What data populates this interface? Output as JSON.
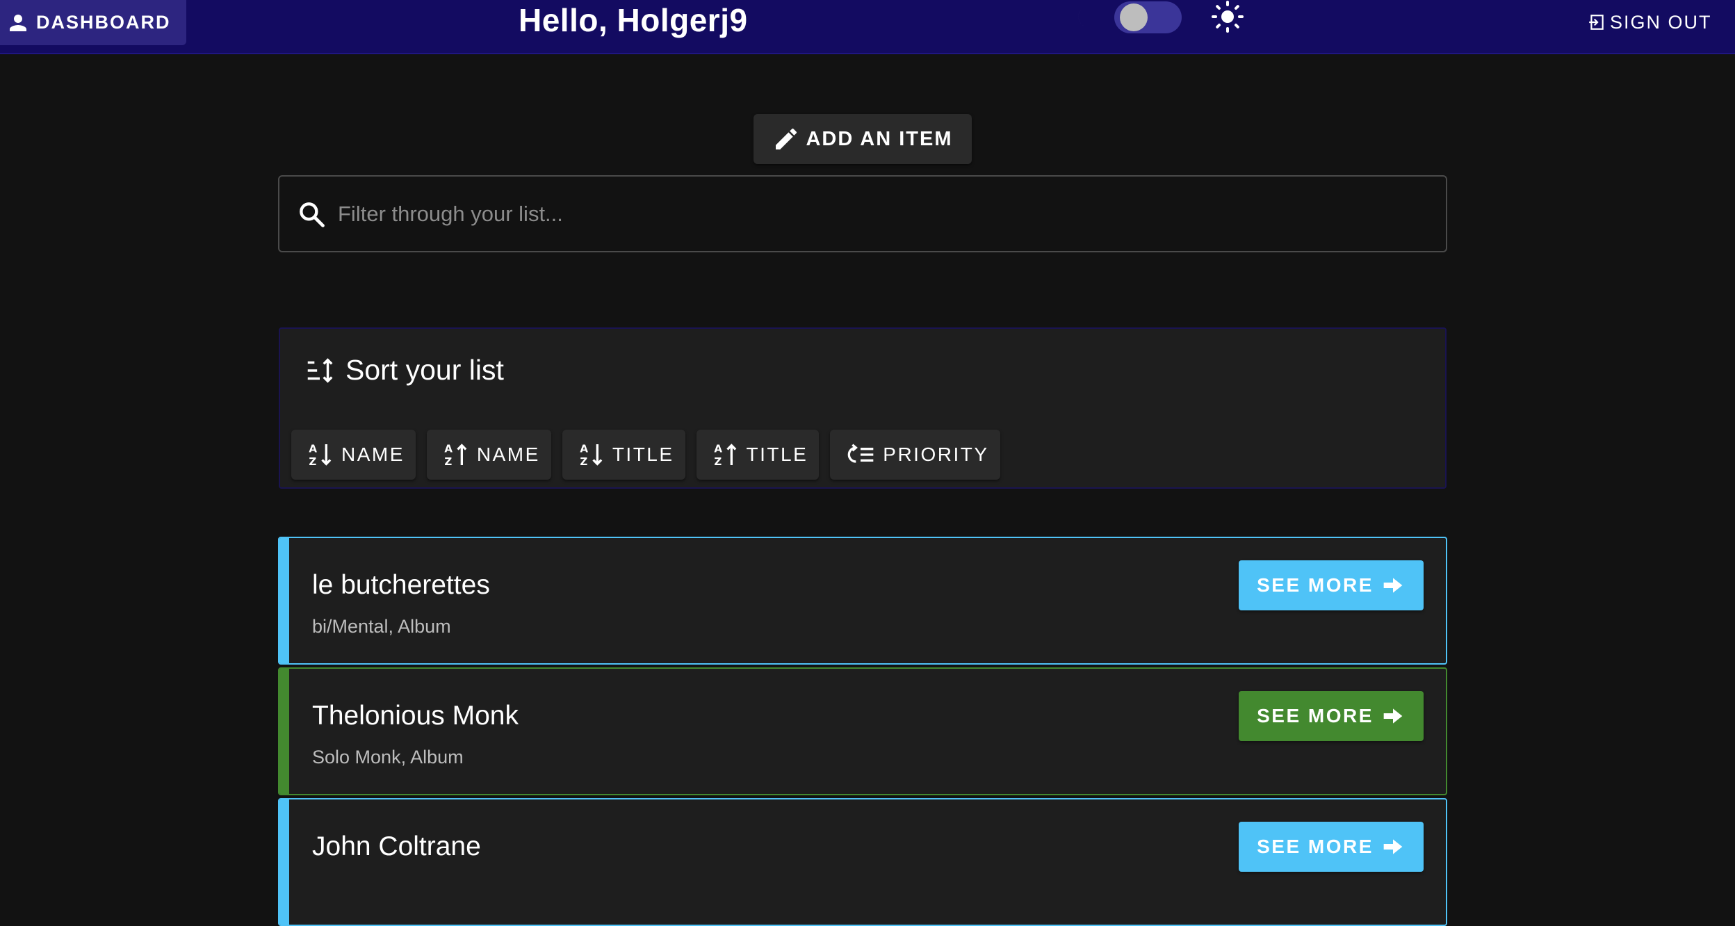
{
  "header": {
    "dashboard_label": "DASHBOARD",
    "greeting": "Hello, Holgerj9",
    "signout_label": "SIGN OUT",
    "theme_toggle": {
      "dark_mode": false
    }
  },
  "toolbar": {
    "add_item_label": "ADD AN ITEM"
  },
  "search": {
    "placeholder": "Filter through your list...",
    "value": ""
  },
  "sort": {
    "title": "Sort your list",
    "buttons": [
      {
        "label": "NAME",
        "icon": "sort-alpha-down-icon"
      },
      {
        "label": "NAME",
        "icon": "sort-alpha-up-icon"
      },
      {
        "label": "TITLE",
        "icon": "sort-alpha-down-icon"
      },
      {
        "label": "TITLE",
        "icon": "sort-alpha-up-icon"
      },
      {
        "label": "PRIORITY",
        "icon": "priority-icon"
      }
    ]
  },
  "items": [
    {
      "name": "le butcherettes",
      "subtitle": "bi/Mental, Album",
      "button_label": "SEE MORE",
      "color": "#4fc3f7"
    },
    {
      "name": "Thelonious Monk",
      "subtitle": "Solo Monk, Album",
      "button_label": "SEE MORE",
      "color": "#43892f"
    },
    {
      "name": "John Coltrane",
      "subtitle": "",
      "button_label": "SEE MORE",
      "color": "#4fc3f7"
    }
  ],
  "colors": {
    "topbar": "#130b61",
    "background": "#121212",
    "surface": "#1e1e1e",
    "accent_blue": "#4fc3f7",
    "accent_green": "#43892f"
  }
}
